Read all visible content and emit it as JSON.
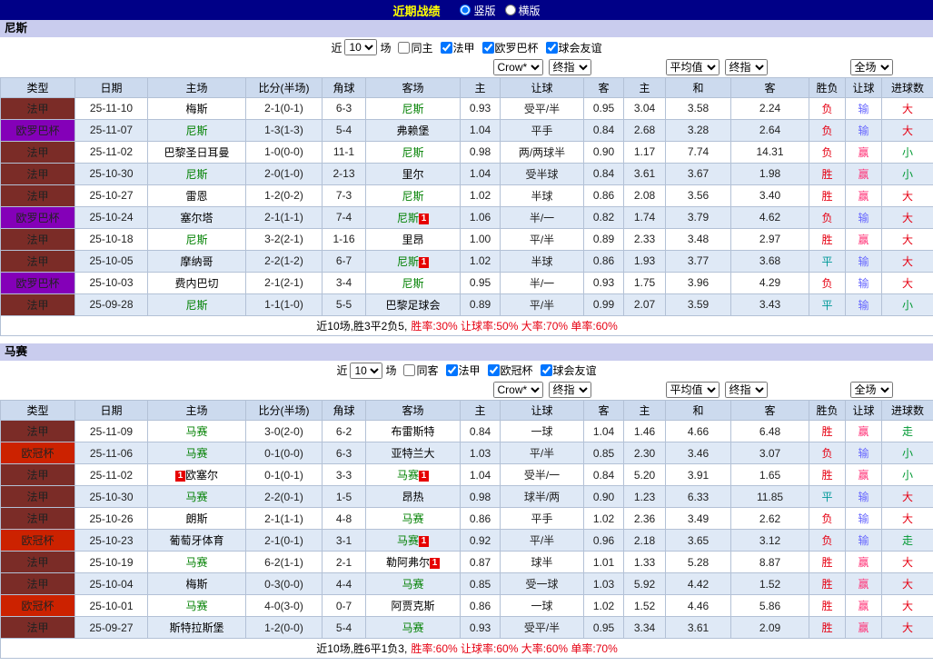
{
  "topbar": {
    "title": "近期战绩",
    "bg": "#000087",
    "title_color": "#ffff00",
    "options": [
      {
        "label": "竖版",
        "selected": true
      },
      {
        "label": "横版",
        "selected": false
      }
    ]
  },
  "filter_labels": {
    "near": "近",
    "games": "场"
  },
  "columns": [
    "类型",
    "日期",
    "主场",
    "比分(半场)",
    "角球",
    "客场",
    "主",
    "让球",
    "客",
    "主",
    "和",
    "客",
    "胜负",
    "让球",
    "进球数"
  ],
  "header_selects": {
    "asia": [
      "Crow*",
      "终指"
    ],
    "euro": [
      "平均值",
      "终指"
    ],
    "full": [
      "全场"
    ]
  },
  "comp_colors": {
    "法甲": "#7b2c27",
    "欧罗巴杯": "#8400b8",
    "欧冠杯": "#cc2200"
  },
  "result_colors": {
    "r": "#e60012",
    "b": "#6666ff",
    "g": "#009933",
    "t": "#009999",
    "p": "#ff3377"
  },
  "colors": {
    "self_team": "#008000",
    "opponent": "#000000",
    "score": "#e60012",
    "badge_bg": "#e60000"
  },
  "sections": [
    {
      "team": "尼斯",
      "filter": {
        "count": "10",
        "checks": [
          {
            "label": "同主",
            "checked": false
          },
          {
            "label": "法甲",
            "checked": true
          },
          {
            "label": "欧罗巴杯",
            "checked": true
          },
          {
            "label": "球会友谊",
            "checked": true
          }
        ]
      },
      "rows": [
        {
          "comp": "法甲",
          "date": "25-11-10",
          "home": {
            "name": "梅斯",
            "self": false
          },
          "score": "2-1(0-1)",
          "corner": "6-3",
          "away": {
            "name": "尼斯",
            "self": true
          },
          "asia": [
            "0.93",
            "受平/半",
            "0.95"
          ],
          "euro": [
            "3.04",
            "3.58",
            "2.24"
          ],
          "result": [
            [
              "负",
              "r"
            ],
            [
              "输",
              "b"
            ],
            [
              "大",
              "r"
            ]
          ]
        },
        {
          "comp": "欧罗巴杯",
          "date": "25-11-07",
          "home": {
            "name": "尼斯",
            "self": true
          },
          "score": "1-3(1-3)",
          "corner": "5-4",
          "away": {
            "name": "弗赖堡",
            "self": false
          },
          "asia": [
            "1.04",
            "平手",
            "0.84"
          ],
          "euro": [
            "2.68",
            "3.28",
            "2.64"
          ],
          "result": [
            [
              "负",
              "r"
            ],
            [
              "输",
              "b"
            ],
            [
              "大",
              "r"
            ]
          ]
        },
        {
          "comp": "法甲",
          "date": "25-11-02",
          "home": {
            "name": "巴黎圣日耳曼",
            "self": false
          },
          "score": "1-0(0-0)",
          "corner": "11-1",
          "away": {
            "name": "尼斯",
            "self": true
          },
          "asia": [
            "0.98",
            "两/两球半",
            "0.90"
          ],
          "euro": [
            "1.17",
            "7.74",
            "14.31"
          ],
          "result": [
            [
              "负",
              "r"
            ],
            [
              "赢",
              "p"
            ],
            [
              "小",
              "g"
            ]
          ]
        },
        {
          "comp": "法甲",
          "date": "25-10-30",
          "home": {
            "name": "尼斯",
            "self": true
          },
          "score": "2-0(1-0)",
          "corner": "2-13",
          "away": {
            "name": "里尔",
            "self": false
          },
          "asia": [
            "1.04",
            "受半球",
            "0.84"
          ],
          "euro": [
            "3.61",
            "3.67",
            "1.98"
          ],
          "result": [
            [
              "胜",
              "r"
            ],
            [
              "赢",
              "p"
            ],
            [
              "小",
              "g"
            ]
          ]
        },
        {
          "comp": "法甲",
          "date": "25-10-27",
          "home": {
            "name": "雷恩",
            "self": false
          },
          "score": "1-2(0-2)",
          "corner": "7-3",
          "away": {
            "name": "尼斯",
            "self": true
          },
          "asia": [
            "1.02",
            "半球",
            "0.86"
          ],
          "euro": [
            "2.08",
            "3.56",
            "3.40"
          ],
          "result": [
            [
              "胜",
              "r"
            ],
            [
              "赢",
              "p"
            ],
            [
              "大",
              "r"
            ]
          ]
        },
        {
          "comp": "欧罗巴杯",
          "date": "25-10-24",
          "home": {
            "name": "塞尔塔",
            "self": false
          },
          "score": "2-1(1-1)",
          "corner": "7-4",
          "away": {
            "name": "尼斯",
            "self": true,
            "badge": "1",
            "badge_pos": "after"
          },
          "asia": [
            "1.06",
            "半/一",
            "0.82"
          ],
          "euro": [
            "1.74",
            "3.79",
            "4.62"
          ],
          "result": [
            [
              "负",
              "r"
            ],
            [
              "输",
              "b"
            ],
            [
              "大",
              "r"
            ]
          ]
        },
        {
          "comp": "法甲",
          "date": "25-10-18",
          "home": {
            "name": "尼斯",
            "self": true
          },
          "score": "3-2(2-1)",
          "corner": "1-16",
          "away": {
            "name": "里昂",
            "self": false
          },
          "asia": [
            "1.00",
            "平/半",
            "0.89"
          ],
          "euro": [
            "2.33",
            "3.48",
            "2.97"
          ],
          "result": [
            [
              "胜",
              "r"
            ],
            [
              "赢",
              "p"
            ],
            [
              "大",
              "r"
            ]
          ]
        },
        {
          "comp": "法甲",
          "date": "25-10-05",
          "home": {
            "name": "摩纳哥",
            "self": false
          },
          "score": "2-2(1-2)",
          "corner": "6-7",
          "away": {
            "name": "尼斯",
            "self": true,
            "badge": "1",
            "badge_pos": "after"
          },
          "asia": [
            "1.02",
            "半球",
            "0.86"
          ],
          "euro": [
            "1.93",
            "3.77",
            "3.68"
          ],
          "result": [
            [
              "平",
              "t"
            ],
            [
              "输",
              "b"
            ],
            [
              "大",
              "r"
            ]
          ]
        },
        {
          "comp": "欧罗巴杯",
          "date": "25-10-03",
          "home": {
            "name": "费内巴切",
            "self": false
          },
          "score": "2-1(2-1)",
          "corner": "3-4",
          "away": {
            "name": "尼斯",
            "self": true
          },
          "asia": [
            "0.95",
            "半/一",
            "0.93"
          ],
          "euro": [
            "1.75",
            "3.96",
            "4.29"
          ],
          "result": [
            [
              "负",
              "r"
            ],
            [
              "输",
              "b"
            ],
            [
              "大",
              "r"
            ]
          ]
        },
        {
          "comp": "法甲",
          "date": "25-09-28",
          "home": {
            "name": "尼斯",
            "self": true
          },
          "score": "1-1(1-0)",
          "corner": "5-5",
          "away": {
            "name": "巴黎足球会",
            "self": false
          },
          "asia": [
            "0.89",
            "平/半",
            "0.99"
          ],
          "euro": [
            "2.07",
            "3.59",
            "3.43"
          ],
          "result": [
            [
              "平",
              "t"
            ],
            [
              "输",
              "b"
            ],
            [
              "小",
              "g"
            ]
          ]
        }
      ],
      "summary": {
        "prefix": "近10场,胜3平2负5,",
        "stats": "胜率:30% 让球率:50% 大率:70% 单率:60%"
      }
    },
    {
      "team": "马赛",
      "filter": {
        "count": "10",
        "checks": [
          {
            "label": "同客",
            "checked": false
          },
          {
            "label": "法甲",
            "checked": true
          },
          {
            "label": "欧冠杯",
            "checked": true
          },
          {
            "label": "球会友谊",
            "checked": true
          }
        ]
      },
      "rows": [
        {
          "comp": "法甲",
          "date": "25-11-09",
          "home": {
            "name": "马赛",
            "self": true
          },
          "score": "3-0(2-0)",
          "corner": "6-2",
          "away": {
            "name": "布雷斯特",
            "self": false
          },
          "asia": [
            "0.84",
            "一球",
            "1.04"
          ],
          "euro": [
            "1.46",
            "4.66",
            "6.48"
          ],
          "result": [
            [
              "胜",
              "r"
            ],
            [
              "赢",
              "p"
            ],
            [
              "走",
              "g"
            ]
          ]
        },
        {
          "comp": "欧冠杯",
          "date": "25-11-06",
          "home": {
            "name": "马赛",
            "self": true
          },
          "score": "0-1(0-0)",
          "corner": "6-3",
          "away": {
            "name": "亚特兰大",
            "self": false
          },
          "asia": [
            "1.03",
            "平/半",
            "0.85"
          ],
          "euro": [
            "2.30",
            "3.46",
            "3.07"
          ],
          "result": [
            [
              "负",
              "r"
            ],
            [
              "输",
              "b"
            ],
            [
              "小",
              "g"
            ]
          ]
        },
        {
          "comp": "法甲",
          "date": "25-11-02",
          "home": {
            "name": "欧塞尔",
            "self": false,
            "badge": "1",
            "badge_pos": "before"
          },
          "score": "0-1(0-1)",
          "corner": "3-3",
          "away": {
            "name": "马赛",
            "self": true,
            "badge": "1",
            "badge_pos": "after"
          },
          "asia": [
            "1.04",
            "受半/一",
            "0.84"
          ],
          "euro": [
            "5.20",
            "3.91",
            "1.65"
          ],
          "result": [
            [
              "胜",
              "r"
            ],
            [
              "赢",
              "p"
            ],
            [
              "小",
              "g"
            ]
          ]
        },
        {
          "comp": "法甲",
          "date": "25-10-30",
          "home": {
            "name": "马赛",
            "self": true
          },
          "score": "2-2(0-1)",
          "corner": "1-5",
          "away": {
            "name": "昂热",
            "self": false
          },
          "asia": [
            "0.98",
            "球半/两",
            "0.90"
          ],
          "euro": [
            "1.23",
            "6.33",
            "11.85"
          ],
          "result": [
            [
              "平",
              "t"
            ],
            [
              "输",
              "b"
            ],
            [
              "大",
              "r"
            ]
          ]
        },
        {
          "comp": "法甲",
          "date": "25-10-26",
          "home": {
            "name": "朗斯",
            "self": false
          },
          "score": "2-1(1-1)",
          "corner": "4-8",
          "away": {
            "name": "马赛",
            "self": true
          },
          "asia": [
            "0.86",
            "平手",
            "1.02"
          ],
          "euro": [
            "2.36",
            "3.49",
            "2.62"
          ],
          "result": [
            [
              "负",
              "r"
            ],
            [
              "输",
              "b"
            ],
            [
              "大",
              "r"
            ]
          ]
        },
        {
          "comp": "欧冠杯",
          "date": "25-10-23",
          "home": {
            "name": "葡萄牙体育",
            "self": false
          },
          "score": "2-1(0-1)",
          "corner": "3-1",
          "away": {
            "name": "马赛",
            "self": true,
            "badge": "1",
            "badge_pos": "after"
          },
          "asia": [
            "0.92",
            "平/半",
            "0.96"
          ],
          "euro": [
            "2.18",
            "3.65",
            "3.12"
          ],
          "result": [
            [
              "负",
              "r"
            ],
            [
              "输",
              "b"
            ],
            [
              "走",
              "g"
            ]
          ]
        },
        {
          "comp": "法甲",
          "date": "25-10-19",
          "home": {
            "name": "马赛",
            "self": true
          },
          "score": "6-2(1-1)",
          "corner": "2-1",
          "away": {
            "name": "勒阿弗尔",
            "self": false,
            "badge": "1",
            "badge_pos": "after"
          },
          "asia": [
            "0.87",
            "球半",
            "1.01"
          ],
          "euro": [
            "1.33",
            "5.28",
            "8.87"
          ],
          "result": [
            [
              "胜",
              "r"
            ],
            [
              "赢",
              "p"
            ],
            [
              "大",
              "r"
            ]
          ]
        },
        {
          "comp": "法甲",
          "date": "25-10-04",
          "home": {
            "name": "梅斯",
            "self": false
          },
          "score": "0-3(0-0)",
          "corner": "4-4",
          "away": {
            "name": "马赛",
            "self": true
          },
          "asia": [
            "0.85",
            "受一球",
            "1.03"
          ],
          "euro": [
            "5.92",
            "4.42",
            "1.52"
          ],
          "result": [
            [
              "胜",
              "r"
            ],
            [
              "赢",
              "p"
            ],
            [
              "大",
              "r"
            ]
          ]
        },
        {
          "comp": "欧冠杯",
          "date": "25-10-01",
          "home": {
            "name": "马赛",
            "self": true
          },
          "score": "4-0(3-0)",
          "corner": "0-7",
          "away": {
            "name": "阿贾克斯",
            "self": false
          },
          "asia": [
            "0.86",
            "一球",
            "1.02"
          ],
          "euro": [
            "1.52",
            "4.46",
            "5.86"
          ],
          "result": [
            [
              "胜",
              "r"
            ],
            [
              "赢",
              "p"
            ],
            [
              "大",
              "r"
            ]
          ]
        },
        {
          "comp": "法甲",
          "date": "25-09-27",
          "home": {
            "name": "斯特拉斯堡",
            "self": false
          },
          "score": "1-2(0-0)",
          "corner": "5-4",
          "away": {
            "name": "马赛",
            "self": true
          },
          "asia": [
            "0.93",
            "受平/半",
            "0.95"
          ],
          "euro": [
            "3.34",
            "3.61",
            "2.09"
          ],
          "result": [
            [
              "胜",
              "r"
            ],
            [
              "赢",
              "p"
            ],
            [
              "大",
              "r"
            ]
          ]
        }
      ],
      "summary": {
        "prefix": "近10场,胜6平1负3,",
        "stats": "胜率:60% 让球率:60% 大率:60% 单率:70%"
      }
    }
  ]
}
